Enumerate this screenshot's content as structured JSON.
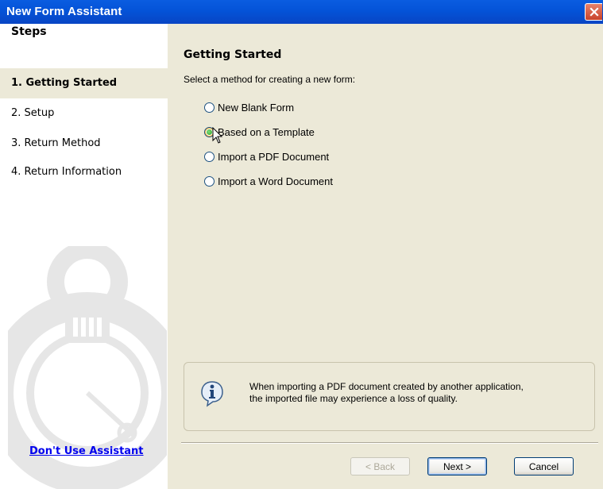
{
  "window": {
    "title": "New Form Assistant"
  },
  "sidebar": {
    "title": "Steps",
    "steps": [
      {
        "label": "1. Getting Started",
        "active": true
      },
      {
        "label": "2. Setup",
        "active": false
      },
      {
        "label": "3. Return Method",
        "active": false
      },
      {
        "label": "4. Return Information",
        "active": false
      }
    ],
    "link_label": "Don't Use Assistant"
  },
  "main": {
    "title": "Getting Started",
    "description": "Select a method for creating a new form:",
    "options": [
      {
        "label": "New Blank Form",
        "checked": false
      },
      {
        "label": "Based on a Template",
        "checked": true
      },
      {
        "label": "Import a PDF Document",
        "checked": false
      },
      {
        "label": "Import a Word Document",
        "checked": false
      }
    ],
    "info": {
      "icon": "info-icon",
      "line1": "When importing a PDF document created by another application,",
      "line2": "the imported file may experience a loss of quality."
    }
  },
  "buttons": {
    "back": "< Back",
    "next": "Next >",
    "cancel": "Cancel"
  },
  "colors": {
    "titlebar": "#0453d8",
    "window_bg": "#ece9d8",
    "link": "#0000ee"
  }
}
